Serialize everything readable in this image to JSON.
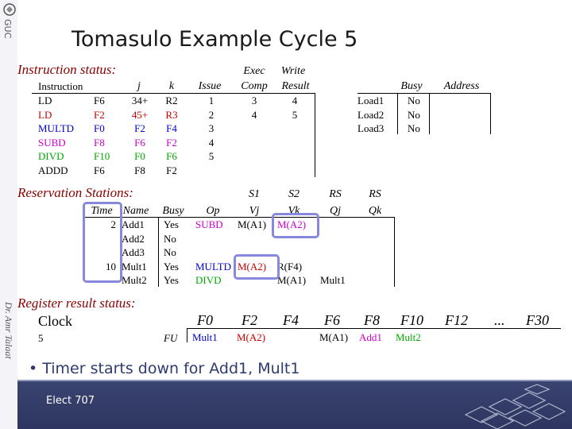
{
  "slide": {
    "title": "Tomasulo Example Cycle 5",
    "logo_text": "GUC",
    "author_vertical": "Dr. Amr Talaat",
    "bullet": "Timer starts down for Add1, Mult1",
    "footer_label": "Elect 707"
  },
  "instruction_status": {
    "section_title": "Instruction status:",
    "headers": {
      "instruction": "Instruction",
      "j": "j",
      "k": "k",
      "issue": "Issue",
      "exec_top": "Exec",
      "exec_bottom": "Comp",
      "write_top": "Write",
      "write_bottom": "Result",
      "busy": "Busy",
      "address": "Address"
    },
    "rows": [
      {
        "op": "LD",
        "dest": "F6",
        "j": "34+",
        "k": "R2",
        "issue": "1",
        "exec": "3",
        "write": "4",
        "color": "blk"
      },
      {
        "op": "LD",
        "dest": "F2",
        "j": "45+",
        "k": "R3",
        "issue": "2",
        "exec": "4",
        "write": "5",
        "color": "red"
      },
      {
        "op": "MULTD",
        "dest": "F0",
        "j": "F2",
        "k": "F4",
        "issue": "3",
        "exec": "",
        "write": "",
        "color": "blue"
      },
      {
        "op": "SUBD",
        "dest": "F8",
        "j": "F6",
        "k": "F2",
        "issue": "4",
        "exec": "",
        "write": "",
        "color": "mag"
      },
      {
        "op": "DIVD",
        "dest": "F10",
        "j": "F0",
        "k": "F6",
        "issue": "5",
        "exec": "",
        "write": "",
        "color": "grn"
      },
      {
        "op": "ADDD",
        "dest": "F6",
        "j": "F8",
        "k": "F2",
        "issue": "",
        "exec": "",
        "write": "",
        "color": "blk"
      }
    ],
    "load_buffers": [
      {
        "name": "Load1",
        "busy": "No",
        "address": ""
      },
      {
        "name": "Load2",
        "busy": "No",
        "address": ""
      },
      {
        "name": "Load3",
        "busy": "No",
        "address": ""
      }
    ]
  },
  "reservation_stations": {
    "section_title": "Reservation Stations:",
    "headers": {
      "time": "Time",
      "name": "Name",
      "busy": "Busy",
      "op": "Op",
      "s1_top": "S1",
      "s1_bottom": "Vj",
      "s2_top": "S2",
      "s2_bottom": "Vk",
      "rs_j_top": "RS",
      "rs_j_bottom": "Qj",
      "rs_k_top": "RS",
      "rs_k_bottom": "Qk"
    },
    "rows": [
      {
        "time": "2",
        "name": "Add1",
        "busy": "Yes",
        "op": "SUBD",
        "vj": "M(A1)",
        "vk": "M(A2)",
        "qj": "",
        "qk": "",
        "op_color": "mag"
      },
      {
        "time": "",
        "name": "Add2",
        "busy": "No",
        "op": "",
        "vj": "",
        "vk": "",
        "qj": "",
        "qk": "",
        "op_color": "blk"
      },
      {
        "time": "",
        "name": "Add3",
        "busy": "No",
        "op": "",
        "vj": "",
        "vk": "",
        "qj": "",
        "qk": "",
        "op_color": "blk"
      },
      {
        "time": "10",
        "name": "Mult1",
        "busy": "Yes",
        "op": "MULTD",
        "vj": "M(A2)",
        "vk": "R(F4)",
        "qj": "",
        "qk": "",
        "op_color": "blue"
      },
      {
        "time": "",
        "name": "Mult2",
        "busy": "Yes",
        "op": "DIVD",
        "vj": "",
        "vk": "M(A1)",
        "qj": "Mult1",
        "qk": "",
        "op_color": "grn"
      }
    ]
  },
  "register_status": {
    "section_title": "Register result status:",
    "clock_label": "Clock",
    "clock_value": "5",
    "fu_label": "FU",
    "registers": [
      "F0",
      "F2",
      "F4",
      "F6",
      "F8",
      "F10",
      "F12",
      "...",
      "F30"
    ],
    "values": [
      {
        "text": "Mult1",
        "color": "blue"
      },
      {
        "text": "M(A2)",
        "color": "red"
      },
      {
        "text": "",
        "color": "blk"
      },
      {
        "text": "M(A1)",
        "color": "blk"
      },
      {
        "text": "Add1",
        "color": "mag"
      },
      {
        "text": "Mult2",
        "color": "grn"
      },
      {
        "text": "",
        "color": "blk"
      },
      {
        "text": "",
        "color": "blk"
      },
      {
        "text": "",
        "color": "blk"
      }
    ]
  }
}
